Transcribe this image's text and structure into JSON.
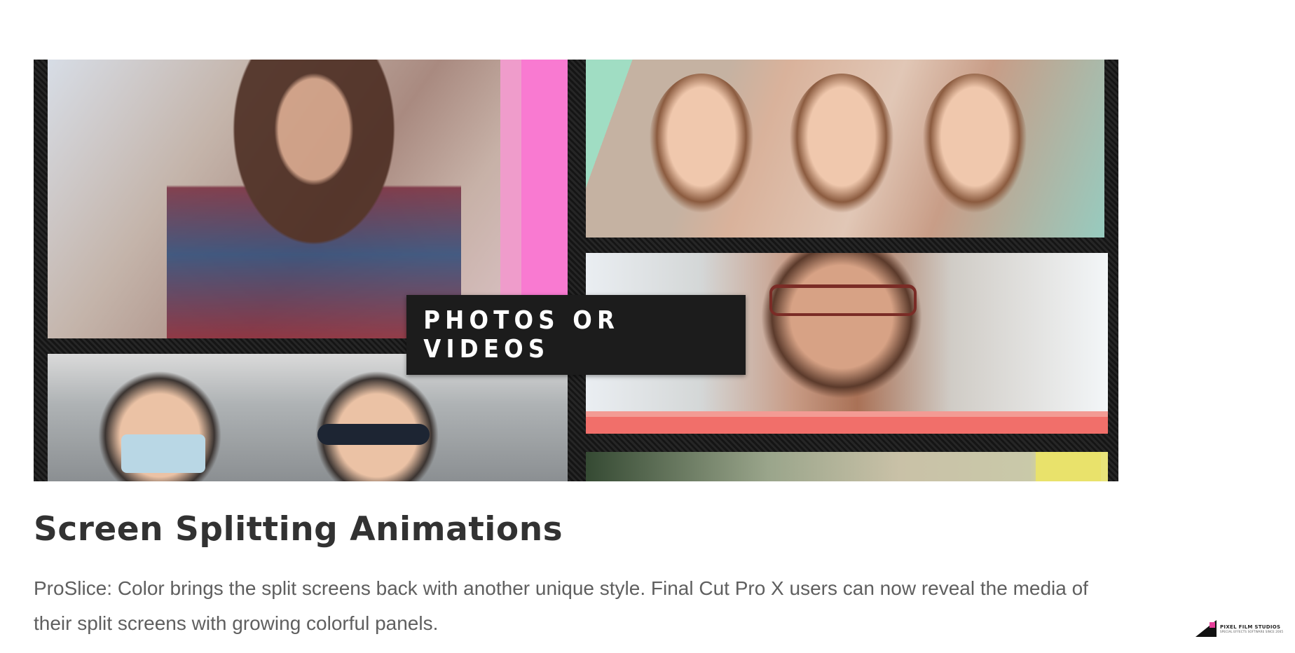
{
  "hero": {
    "overlay_text": "PHOTOS OR VIDEOS",
    "accent_colors": {
      "pink": "#f97ad1",
      "mint": "#a0ddc3",
      "coral": "#f16f6a",
      "yellow": "#e9e26b"
    }
  },
  "content": {
    "title": "Screen Splitting Animations",
    "description": "ProSlice: Color brings the split screens back with another unique style. Final Cut Pro X users can now reveal the media of their split screens with growing colorful panels."
  },
  "brand": {
    "name": "PIXEL FILM STUDIOS",
    "tagline": "SPECIAL EFFECTS SOFTWARE SINCE 2005"
  }
}
